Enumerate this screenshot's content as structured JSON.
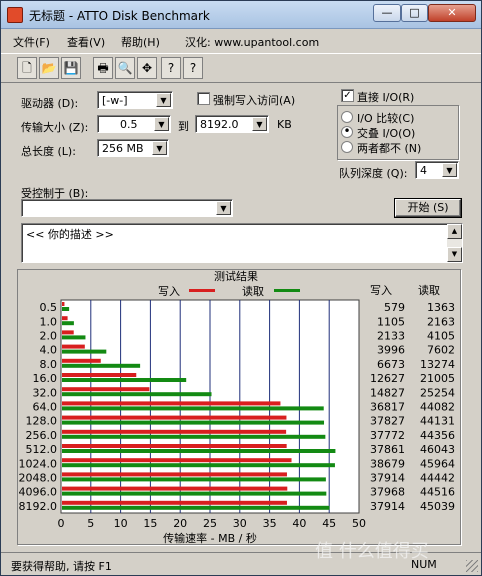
{
  "window": {
    "title": "无标题 - ATTO Disk Benchmark",
    "controls": {
      "minimize": "—",
      "maximize": "□",
      "close": "✕"
    }
  },
  "menu": {
    "items": [
      "文件(F)",
      "查看(V)",
      "帮助(H)",
      "汉化: www.upantool.com"
    ]
  },
  "toolbar": {
    "icons": [
      "new-document-icon",
      "open-folder-icon",
      "save-icon",
      "print-icon",
      "print-preview-icon",
      "move-icon",
      "help-icon",
      "context-help-icon"
    ],
    "glyphs": [
      "🗋",
      "📂",
      "💾",
      "🖶",
      "🔍",
      "✥",
      "?",
      "?"
    ]
  },
  "form": {
    "drive_label": "驱动器 (D):",
    "drive_value": "[-w-]",
    "transfer_size_label": "传输大小 (Z):",
    "transfer_from": "0.5",
    "to_label": "到",
    "transfer_to": "8192.0",
    "kb_label": "KB",
    "total_length_label": "总长度 (L):",
    "total_length_value": "256 MB",
    "force_write_label": "强制写入访问(A)",
    "force_write_checked": false,
    "direct_io_label": "直接 I/O(R)",
    "direct_io_checked": true,
    "io_compare_label": "I/O 比较(C)",
    "io_overlap_label": "交叠 I/O(O)",
    "neither_label": "两者都不 (N)",
    "io_selected": "交叠 I/O(O)",
    "queue_depth_label": "队列深度 (Q):",
    "queue_depth_value": "4",
    "controlled_by_label": "受控制于 (B):",
    "controlled_by_value": "",
    "start_button": "开始 (S)",
    "description_text": "<<   你的描述   >>"
  },
  "results": {
    "title": "测试结果",
    "write_header": "写入",
    "read_header": "读取"
  },
  "chart_data": {
    "type": "bar",
    "orientation": "horizontal",
    "title": "测试结果",
    "xlabel": "传输速率 - MB / 秒",
    "xlim": [
      0,
      50
    ],
    "xticks": [
      "0",
      "5",
      "10",
      "15",
      "20",
      "25",
      "30",
      "35",
      "40",
      "45",
      "50"
    ],
    "categories": [
      "0.5",
      "1.0",
      "2.0",
      "4.0",
      "8.0",
      "16.0",
      "32.0",
      "64.0",
      "128.0",
      "256.0",
      "512.0",
      "1024.0",
      "2048.0",
      "4096.0",
      "8192.0"
    ],
    "series": [
      {
        "name": "写入",
        "color": "#d81f1f",
        "values": [
          579,
          1105,
          2133,
          3996,
          6673,
          12627,
          14827,
          36817,
          37827,
          37772,
          37861,
          38679,
          37914,
          37968,
          37914
        ]
      },
      {
        "name": "读取",
        "color": "#138a13",
        "values": [
          1363,
          2163,
          4105,
          7602,
          13274,
          21005,
          25254,
          44082,
          44131,
          44356,
          46043,
          45964,
          44442,
          44516,
          45039
        ]
      }
    ],
    "grid": true,
    "legend": "top-center"
  },
  "statusbar": {
    "help_text": "要获得帮助, 请按 F1",
    "num_indicator": "NUM"
  },
  "watermark": {
    "text": "值 什么值得买"
  }
}
